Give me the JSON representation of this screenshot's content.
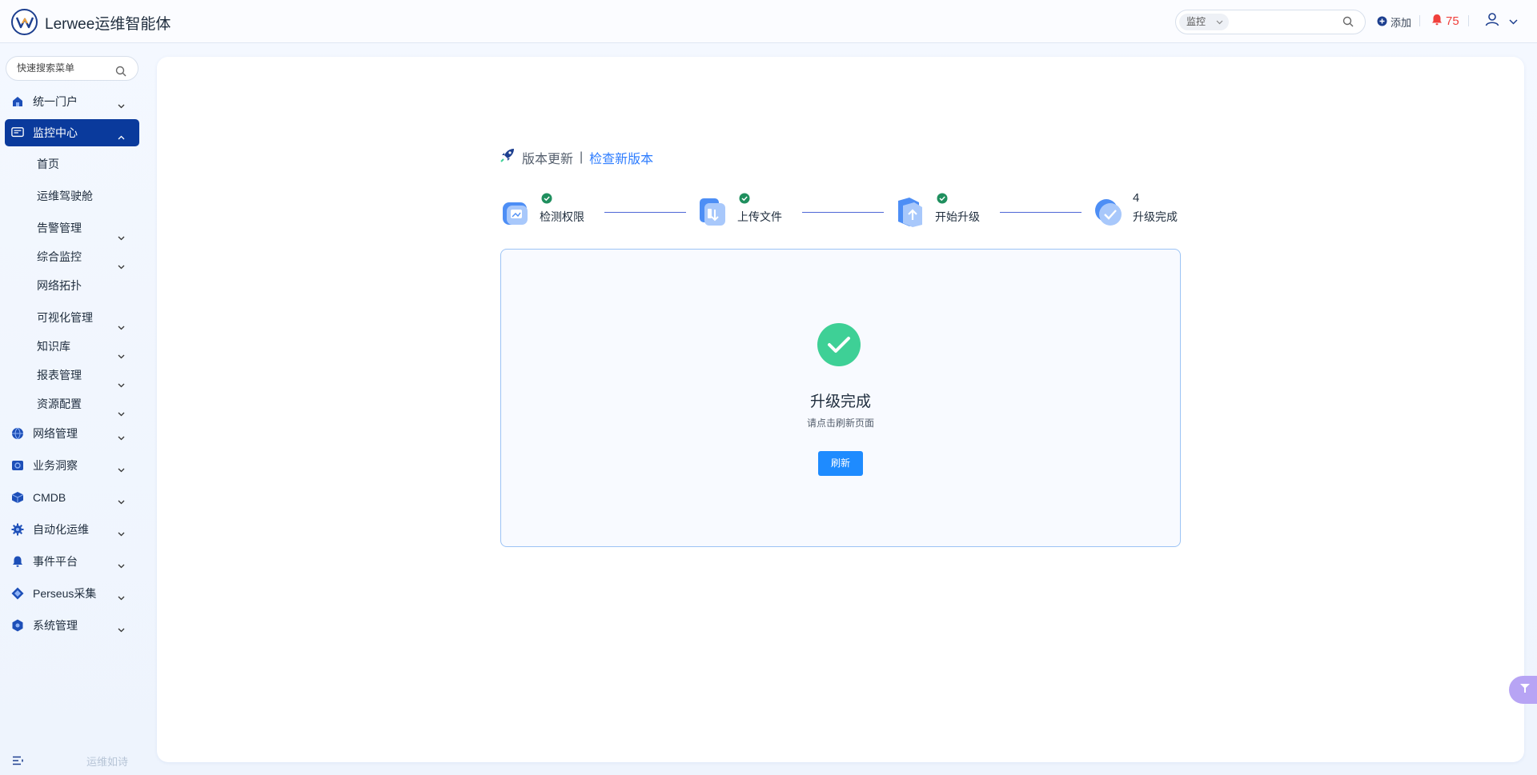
{
  "header": {
    "app_title": "Lerwee运维智能体",
    "search": {
      "scope": "监控",
      "placeholder": ""
    },
    "add_label": "添加",
    "alert_count": "75"
  },
  "sidebar": {
    "search_placeholder": "快速搜索菜单",
    "items": [
      {
        "label": "统一门户",
        "icon": "home-icon",
        "expanded": false
      },
      {
        "label": "监控中心",
        "icon": "monitor-icon",
        "expanded": true,
        "active": true
      },
      {
        "label": "网络管理",
        "icon": "globe-icon",
        "expanded": false
      },
      {
        "label": "业务洞察",
        "icon": "insight-icon",
        "expanded": false
      },
      {
        "label": "CMDB",
        "icon": "cube-icon",
        "expanded": false
      },
      {
        "label": "自动化运维",
        "icon": "gear-icon",
        "expanded": false
      },
      {
        "label": "事件平台",
        "icon": "bell-icon",
        "expanded": false
      },
      {
        "label": "Perseus采集",
        "icon": "diamond-icon",
        "expanded": false
      },
      {
        "label": "系统管理",
        "icon": "settings-icon",
        "expanded": false
      }
    ],
    "sub_items": [
      {
        "label": "首页",
        "has_children": false
      },
      {
        "label": "运维驾驶舱",
        "has_children": false
      },
      {
        "label": "告警管理",
        "has_children": true
      },
      {
        "label": "综合监控",
        "has_children": true
      },
      {
        "label": "网络拓扑",
        "has_children": false
      },
      {
        "label": "可视化管理",
        "has_children": true
      },
      {
        "label": "知识库",
        "has_children": true
      },
      {
        "label": "报表管理",
        "has_children": true
      },
      {
        "label": "资源配置",
        "has_children": true
      }
    ],
    "footer_motto": "运维如诗"
  },
  "main": {
    "breadcrumb": {
      "section": "版本更新",
      "separator": "|",
      "link": "检查新版本"
    },
    "steps": [
      {
        "label": "检测权限",
        "done": true
      },
      {
        "label": "上传文件",
        "done": true
      },
      {
        "label": "开始升级",
        "done": true
      },
      {
        "label": "升级完成",
        "done": false,
        "number": "4"
      }
    ],
    "result": {
      "title": "升级完成",
      "subtitle": "请点击刷新页面",
      "button_label": "刷新"
    }
  },
  "colors": {
    "primary": "#0a3a9c",
    "accent": "#2e7dff",
    "success": "#3ed096",
    "alert": "#f0403c",
    "button": "#1e8bff"
  }
}
